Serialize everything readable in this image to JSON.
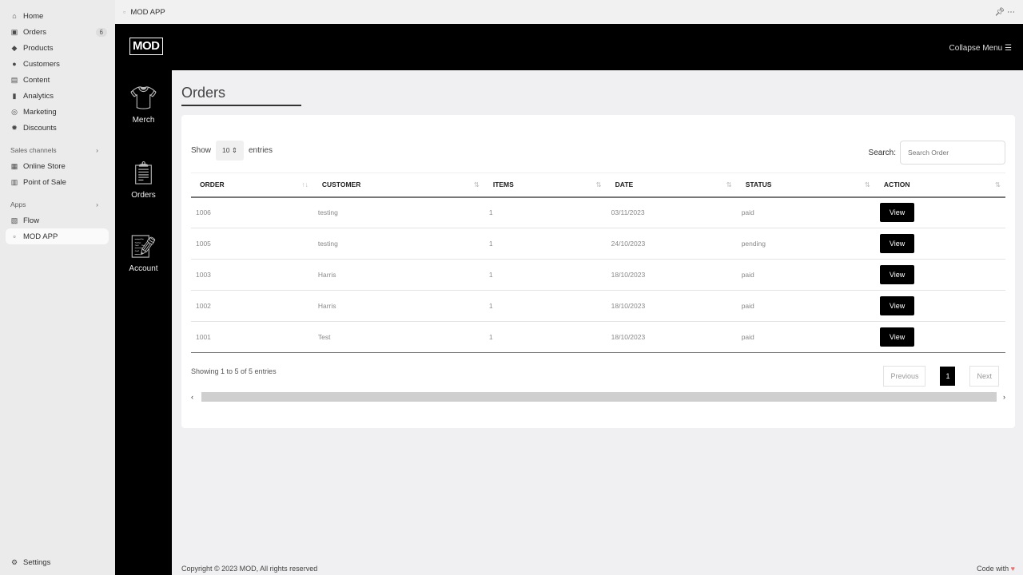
{
  "sidebar": {
    "items": [
      {
        "label": "Home",
        "icon": "home-icon",
        "glyph": "⌂"
      },
      {
        "label": "Orders",
        "icon": "orders-icon",
        "glyph": "▣",
        "badge": "6"
      },
      {
        "label": "Products",
        "icon": "tag-icon",
        "glyph": "◆"
      },
      {
        "label": "Customers",
        "icon": "person-icon",
        "glyph": "●"
      },
      {
        "label": "Content",
        "icon": "content-icon",
        "glyph": "▤"
      },
      {
        "label": "Analytics",
        "icon": "bar-chart-icon",
        "glyph": "▮"
      },
      {
        "label": "Marketing",
        "icon": "target-icon",
        "glyph": "◎"
      },
      {
        "label": "Discounts",
        "icon": "discount-icon",
        "glyph": "✹"
      }
    ],
    "sales_channels": "Sales channels",
    "channels": [
      {
        "label": "Online Store",
        "glyph": "▦"
      },
      {
        "label": "Point of Sale",
        "glyph": "▥"
      }
    ],
    "apps": "Apps",
    "app_items": [
      {
        "label": "Flow",
        "glyph": "▧"
      },
      {
        "label": "MOD APP",
        "glyph": "▫"
      }
    ],
    "settings": "Settings"
  },
  "topbar": {
    "title": "MOD APP"
  },
  "header": {
    "logo": "MOD",
    "collapse": "Collapse Menu"
  },
  "rail": [
    {
      "label": "Merch"
    },
    {
      "label": "Orders"
    },
    {
      "label": "Account"
    }
  ],
  "page": {
    "title": "Orders",
    "show": "Show",
    "entries_value": "10",
    "entries": "entries",
    "search_label": "Search:",
    "search_placeholder": "Search Order"
  },
  "table": {
    "columns": [
      "ORDER",
      "CUSTOMER",
      "ITEMS",
      "DATE",
      "STATUS",
      "ACTION"
    ],
    "rows": [
      [
        "1006",
        "testing",
        "1",
        "03/11/2023",
        "paid",
        "View"
      ],
      [
        "1005",
        "testing",
        "1",
        "24/10/2023",
        "pending",
        "View"
      ],
      [
        "1003",
        "Harris",
        "1",
        "18/10/2023",
        "paid",
        "View"
      ],
      [
        "1002",
        "Harris",
        "1",
        "18/10/2023",
        "paid",
        "View"
      ],
      [
        "1001",
        "Test",
        "1",
        "18/10/2023",
        "paid",
        "View"
      ]
    ]
  },
  "footer_info": "Showing 1 to 5 of 5 entries",
  "pagination": {
    "previous": "Previous",
    "page": "1",
    "next": "Next"
  },
  "footer": {
    "copyright": "Copyright © 2023 MOD, All rights reserved",
    "code": "Code with"
  },
  "colors": {
    "heart": "#e57373",
    "accent": "#000000"
  }
}
